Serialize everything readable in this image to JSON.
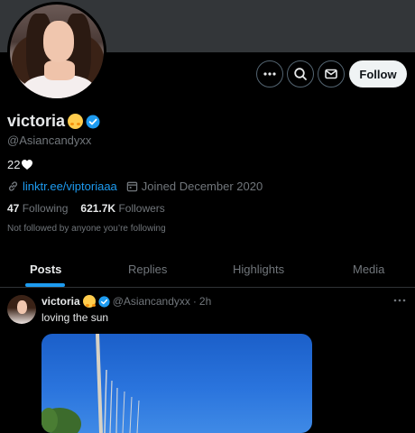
{
  "profile": {
    "name": "victoria",
    "handle": "@Asiancandyxx",
    "bio": "22",
    "link": "linktr.ee/viptoriaaa",
    "joined": "Joined December 2020",
    "following_count": "47",
    "following_label": "Following",
    "followers_count": "621.7K",
    "followers_label": "Followers",
    "not_followed": "Not followed by anyone you’re following"
  },
  "actions": {
    "more_icon": "more-icon",
    "search_icon": "search-icon",
    "message_icon": "mail-icon",
    "follow_label": "Follow"
  },
  "tabs": [
    {
      "label": "Posts",
      "active": true
    },
    {
      "label": "Replies",
      "active": false
    },
    {
      "label": "Highlights",
      "active": false
    },
    {
      "label": "Media",
      "active": false
    }
  ],
  "post": {
    "name": "victoria",
    "handle": "@Asiancandyxx",
    "separator": "·",
    "time": "2h",
    "text": "loving the sun"
  },
  "colors": {
    "background": "#000000",
    "accent": "#1d9bf0",
    "muted": "#71767b",
    "banner": "#333639"
  }
}
